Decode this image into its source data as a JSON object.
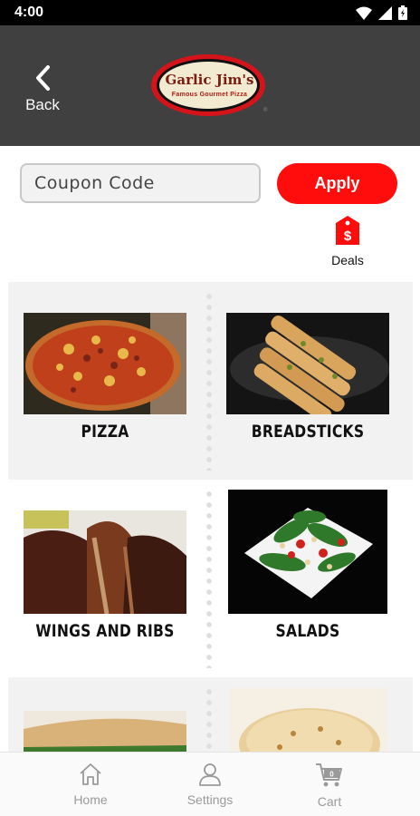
{
  "status_bar": {
    "time": "4:00",
    "icons": [
      "wifi-icon",
      "signal-icon",
      "battery-icon"
    ]
  },
  "header": {
    "back_label": "Back",
    "logo": {
      "line1": "Garlic Jim's",
      "line2": "Famous Gourmet Pizza"
    }
  },
  "coupon": {
    "placeholder": "Coupon Code",
    "value": "",
    "apply_label": "Apply"
  },
  "deals": {
    "label": "Deals",
    "icon": "price-tag-icon"
  },
  "categories": [
    {
      "label": "PIZZA"
    },
    {
      "label": "BREADSTICKS"
    },
    {
      "label": "WINGS AND RIBS"
    },
    {
      "label": "SALADS"
    },
    {
      "label": ""
    },
    {
      "label": ""
    }
  ],
  "bottom_nav": {
    "items": [
      {
        "label": "Home",
        "icon": "home-icon"
      },
      {
        "label": "Settings",
        "icon": "person-icon"
      },
      {
        "label": "Cart",
        "icon": "cart-icon"
      }
    ]
  },
  "colors": {
    "header_bg": "#404040",
    "accent_red": "#ff0d0d",
    "panel_grey": "#f2f2f2",
    "nav_grey": "#9a9a9a"
  }
}
